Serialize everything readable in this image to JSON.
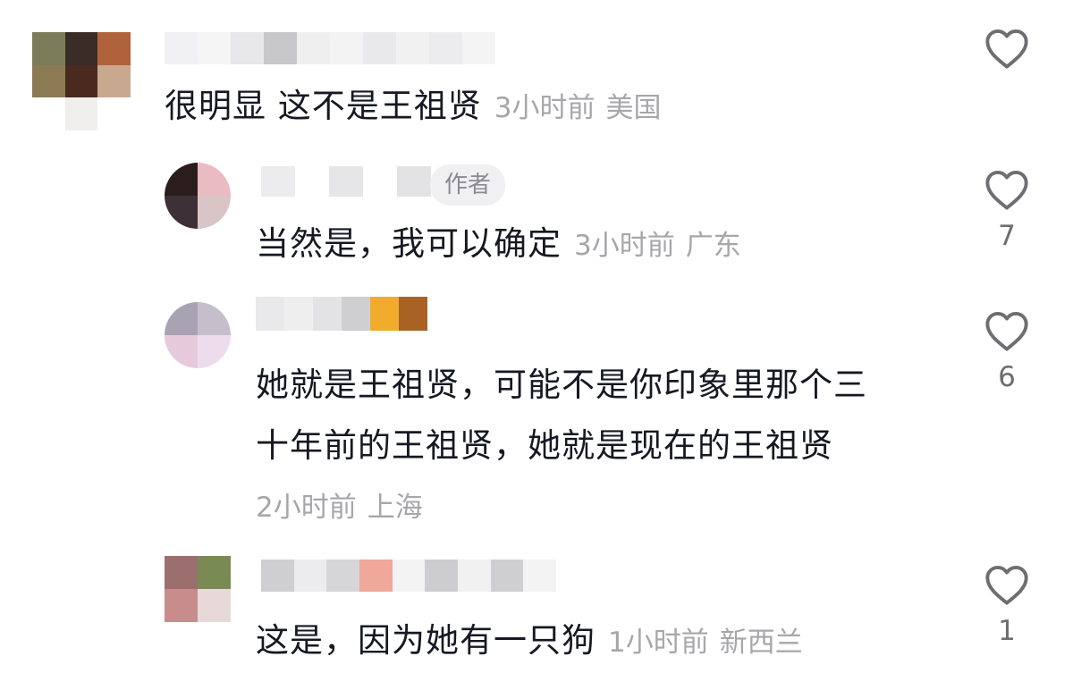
{
  "comments": [
    {
      "text": "很明显 这不是王祖贤",
      "time": "3小时前",
      "location": "美国",
      "likes": ""
    },
    {
      "text": "当然是，我可以确定",
      "time": "3小时前",
      "location": "广东",
      "badge": "作者",
      "likes": "7"
    },
    {
      "text_line1": "她就是王祖贤，可能不是你印象里那个三",
      "text_line2": "十年前的王祖贤，她就是现在的王祖贤",
      "time": "2小时前",
      "location": "上海",
      "likes": "6"
    },
    {
      "text": "这是，因为她有一只狗",
      "time": "1小时前",
      "location": "新西兰",
      "likes": "1"
    }
  ],
  "icons": {
    "like": "heart-outline-icon"
  },
  "colors": {
    "text": "#161823",
    "meta": "#a7a7ab",
    "badge_bg": "#f0f0f2"
  }
}
